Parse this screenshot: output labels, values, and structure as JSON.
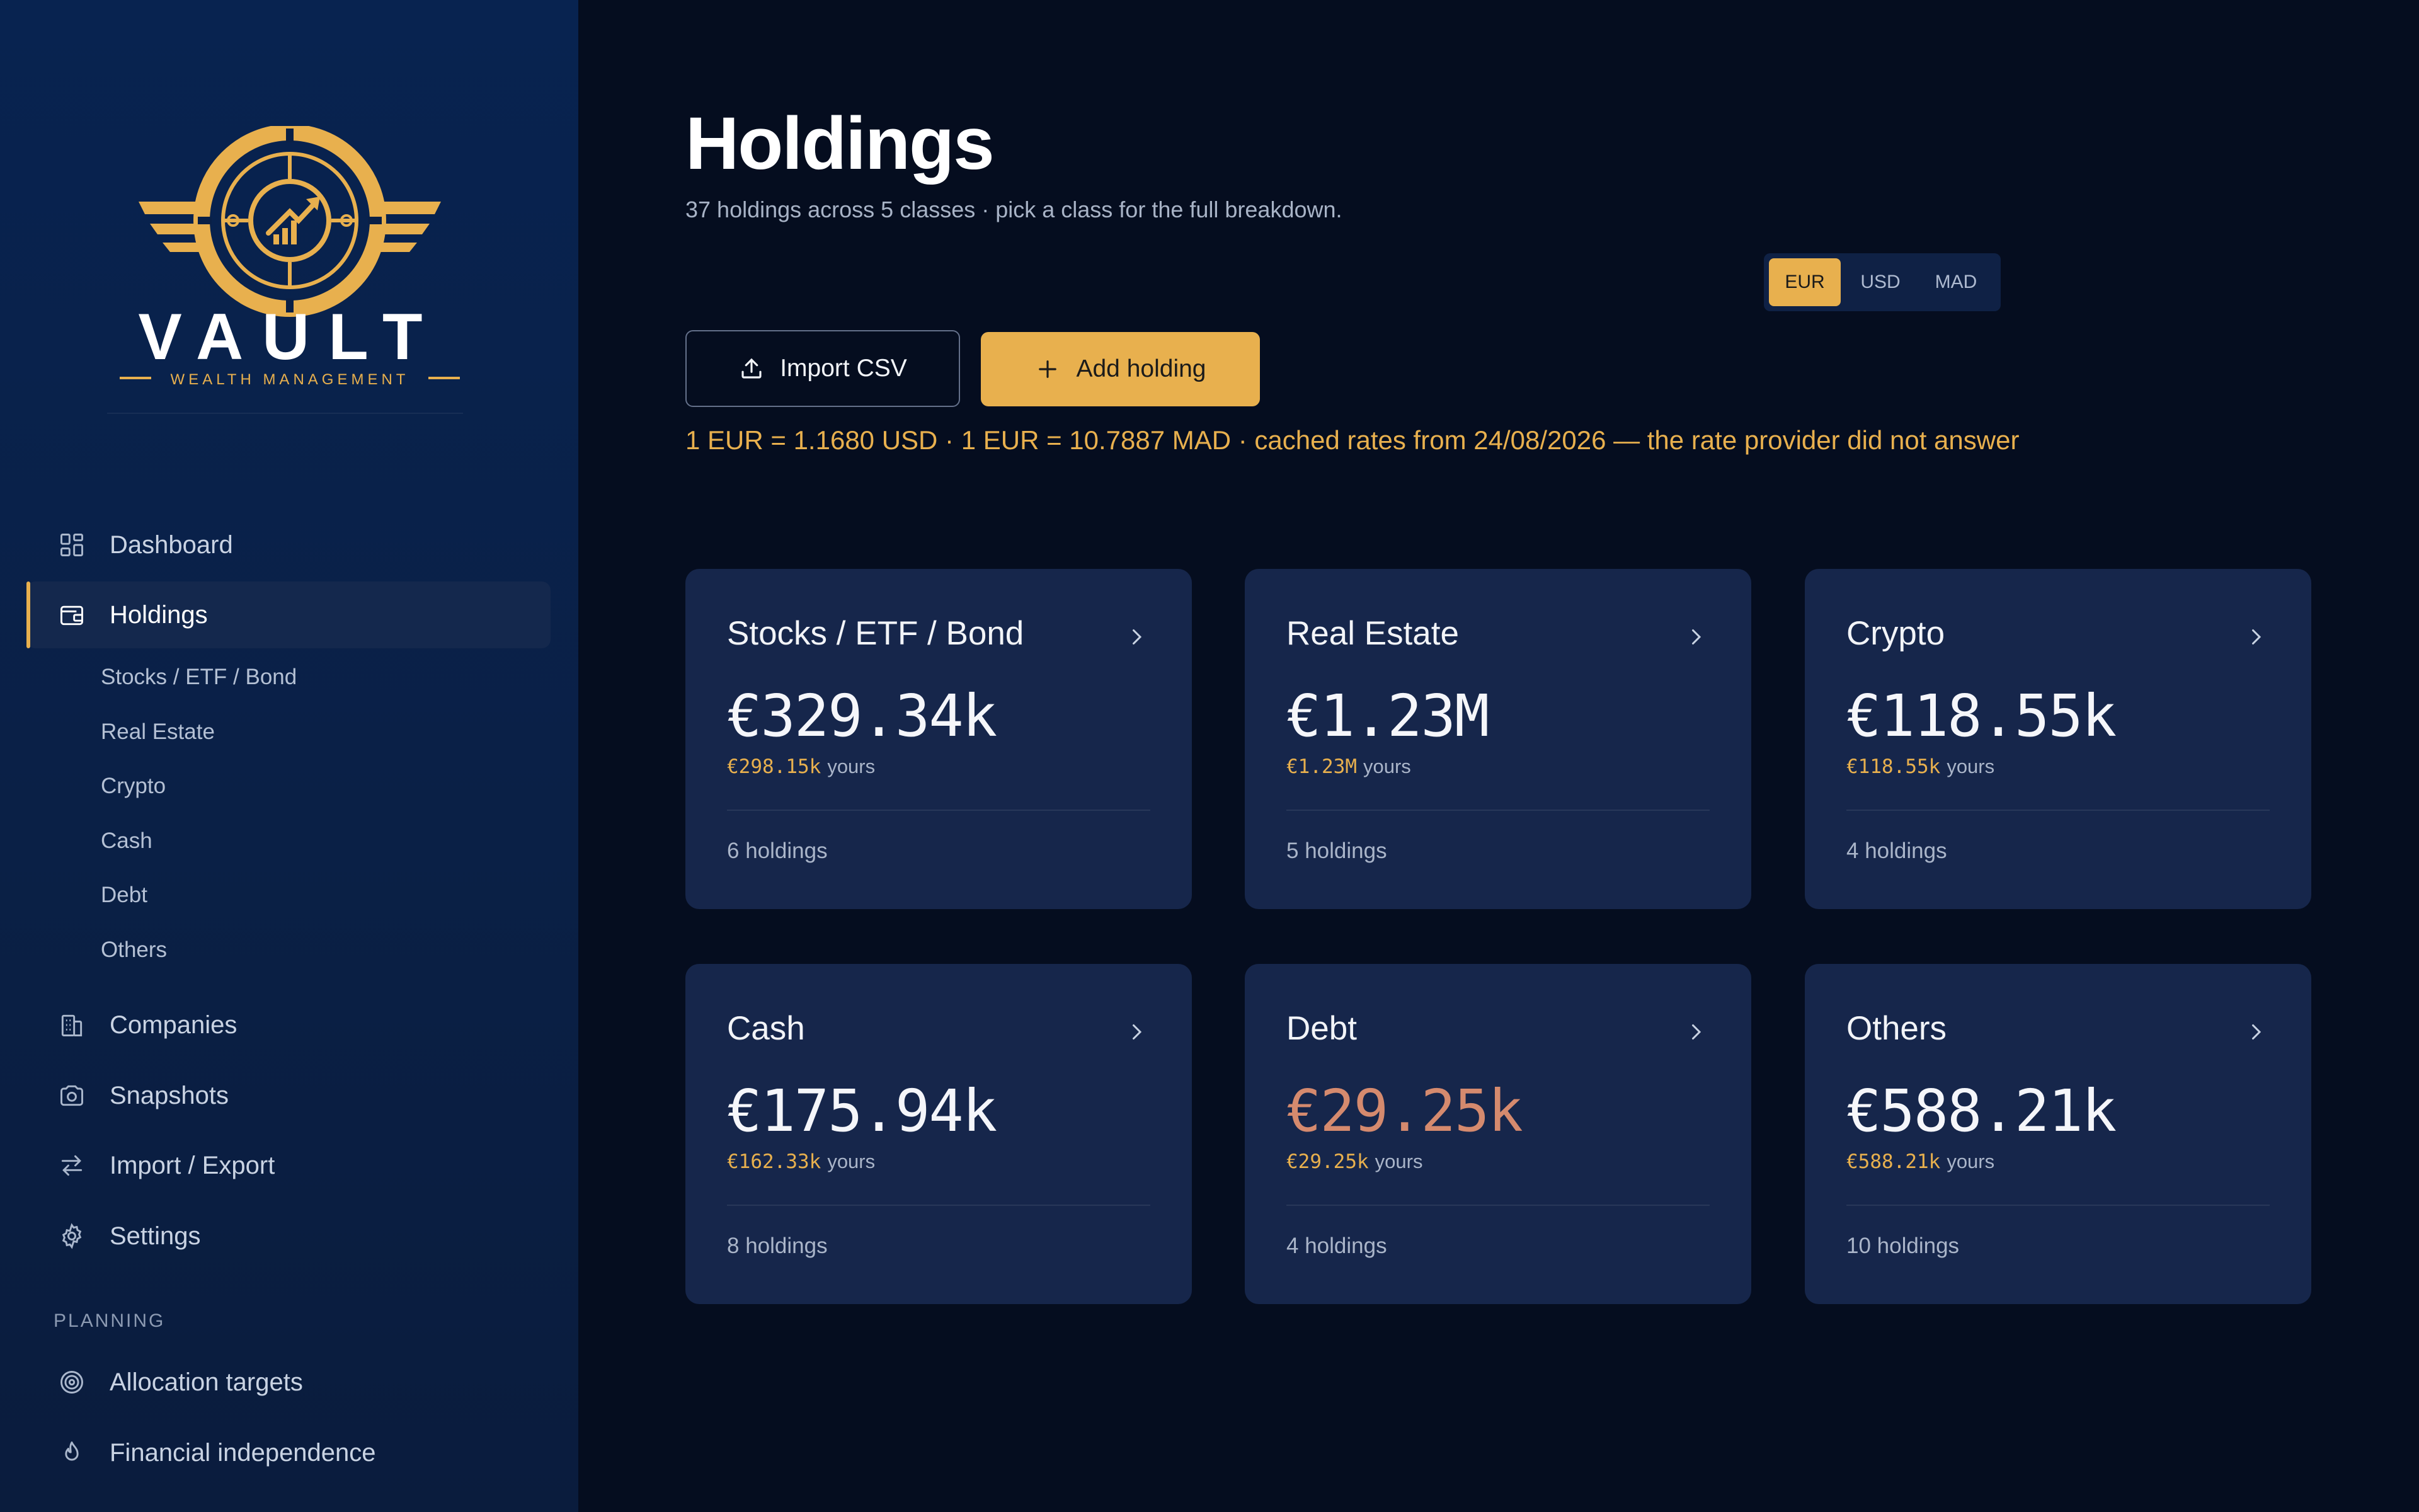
{
  "brand": {
    "name": "VAULT",
    "tagline": "WEALTH MANAGEMENT",
    "accent_color": "#e8b04e"
  },
  "sidebar": {
    "nav": [
      {
        "label": "Dashboard",
        "icon": "grid-icon"
      },
      {
        "label": "Holdings",
        "icon": "wallet-icon",
        "active": true
      },
      {
        "label": "Companies",
        "icon": "building-icon"
      },
      {
        "label": "Snapshots",
        "icon": "camera-icon"
      },
      {
        "label": "Import / Export",
        "icon": "swap-arrows-icon"
      },
      {
        "label": "Settings",
        "icon": "gear-icon"
      }
    ],
    "holdings_sub": [
      "Stocks / ETF / Bond",
      "Real Estate",
      "Crypto",
      "Cash",
      "Debt",
      "Others"
    ],
    "planning_label": "PLANNING",
    "planning": [
      {
        "label": "Allocation targets",
        "icon": "target-icon"
      },
      {
        "label": "Financial independence",
        "icon": "flame-icon"
      }
    ]
  },
  "header": {
    "title": "Holdings",
    "subtitle": "37 holdings across 5 classes · pick a class for the full breakdown."
  },
  "currency": {
    "options": [
      "EUR",
      "USD",
      "MAD"
    ],
    "selected": "EUR"
  },
  "actions": {
    "import_label": "Import CSV",
    "add_label": "Add holding"
  },
  "rate_note": "1 EUR = 1.1680 USD · 1 EUR = 10.7887 MAD · cached rates from 24/08/2026 — the rate provider did not answer",
  "cards": [
    {
      "title": "Stocks / ETF / Bond",
      "value": "€329.34k",
      "yours": "€298.15k",
      "yours_label": "yours",
      "count": "6 holdings"
    },
    {
      "title": "Real Estate",
      "value": "€1.23M",
      "yours": "€1.23M",
      "yours_label": "yours",
      "count": "5 holdings"
    },
    {
      "title": "Crypto",
      "value": "€118.55k",
      "yours": "€118.55k",
      "yours_label": "yours",
      "count": "4 holdings"
    },
    {
      "title": "Cash",
      "value": "€175.94k",
      "yours": "€162.33k",
      "yours_label": "yours",
      "count": "8 holdings"
    },
    {
      "title": "Debt",
      "value": "€29.25k",
      "yours": "€29.25k",
      "yours_label": "yours",
      "count": "4 holdings"
    },
    {
      "title": "Others",
      "value": "€588.21k",
      "yours": "€588.21k",
      "yours_label": "yours",
      "count": "10 holdings"
    }
  ]
}
